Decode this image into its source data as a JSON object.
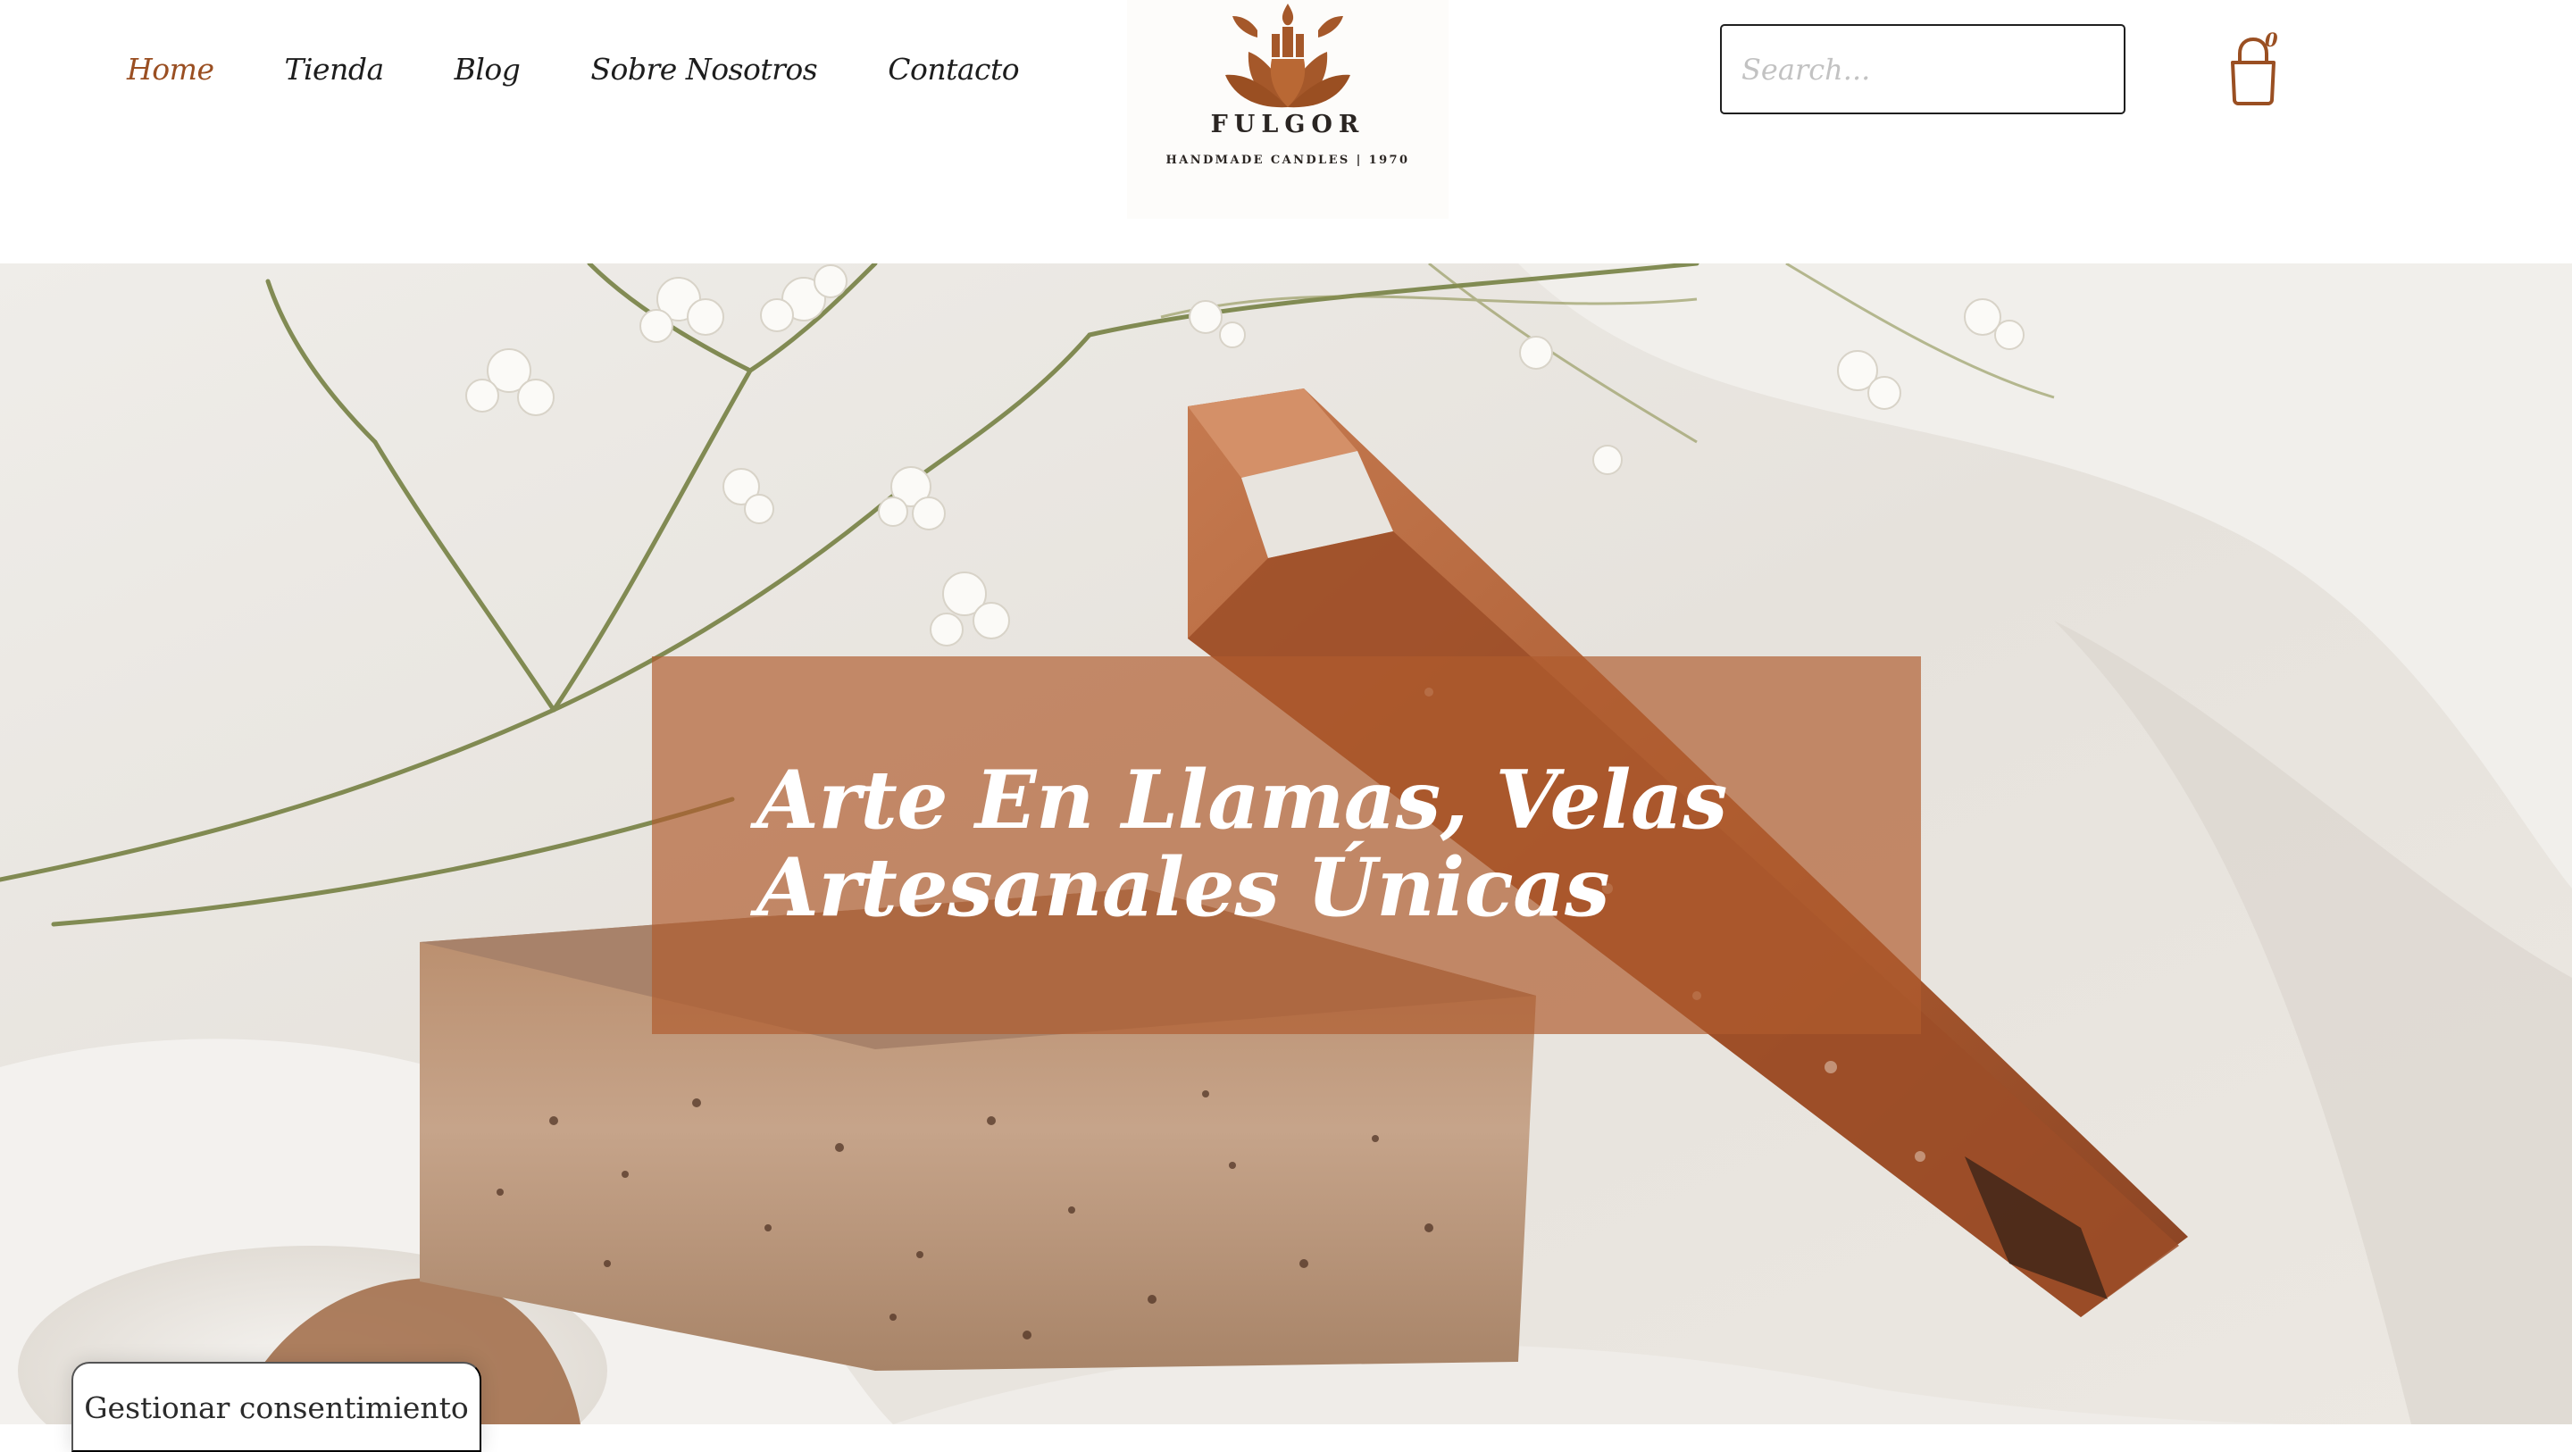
{
  "nav": {
    "items": [
      {
        "label": "Home",
        "active": true
      },
      {
        "label": "Tienda",
        "active": false
      },
      {
        "label": "Blog",
        "active": false
      },
      {
        "label": "Sobre Nosotros",
        "active": false
      },
      {
        "label": "Contacto",
        "active": false
      }
    ]
  },
  "logo": {
    "name": "FULGOR",
    "tagline": "HANDMADE CANDLES | 1970",
    "icon": "lotus-candle-icon"
  },
  "search": {
    "placeholder": "Search..."
  },
  "cart": {
    "count": "0",
    "icon": "shopping-bag-icon"
  },
  "hero": {
    "headline": "Arte En Llamas, Velas Artesanales Únicas"
  },
  "consent": {
    "label": "Gestionar consentimiento"
  },
  "colors": {
    "accent": "#9a4f22",
    "overlay": "#b05c2e",
    "text": "#1d1d1d"
  }
}
